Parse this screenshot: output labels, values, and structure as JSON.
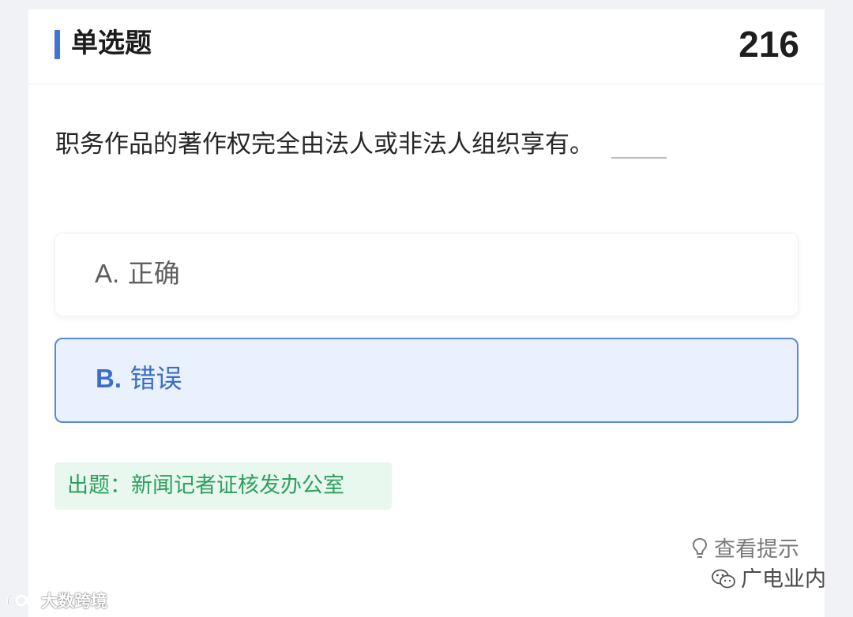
{
  "header": {
    "title": "单选题",
    "question_number": "216"
  },
  "question": {
    "text": "职务作品的著作权完全由法人或非法人组织享有。"
  },
  "options": [
    {
      "letter": "A.",
      "text": "正确",
      "state": "default"
    },
    {
      "letter": "B.",
      "text": "错误",
      "state": "selected"
    }
  ],
  "source": {
    "text": "出题：新闻记者证核发办公室"
  },
  "hint": {
    "label": "查看提示",
    "icon": "lightbulb-icon"
  },
  "watermarks": {
    "right": {
      "text": "广电业内",
      "icon": "wechat-icon"
    },
    "left": {
      "text": "大数跨境",
      "icon": "brand-logo-icon"
    }
  },
  "colors": {
    "accent_blue": "#3f74d6",
    "selected_border": "#5a88d2",
    "selected_bg": "#eaf1fe",
    "selected_text": "#3d6fc9",
    "source_green": "#2f9f5f",
    "source_bg": "#e9f8ee"
  }
}
